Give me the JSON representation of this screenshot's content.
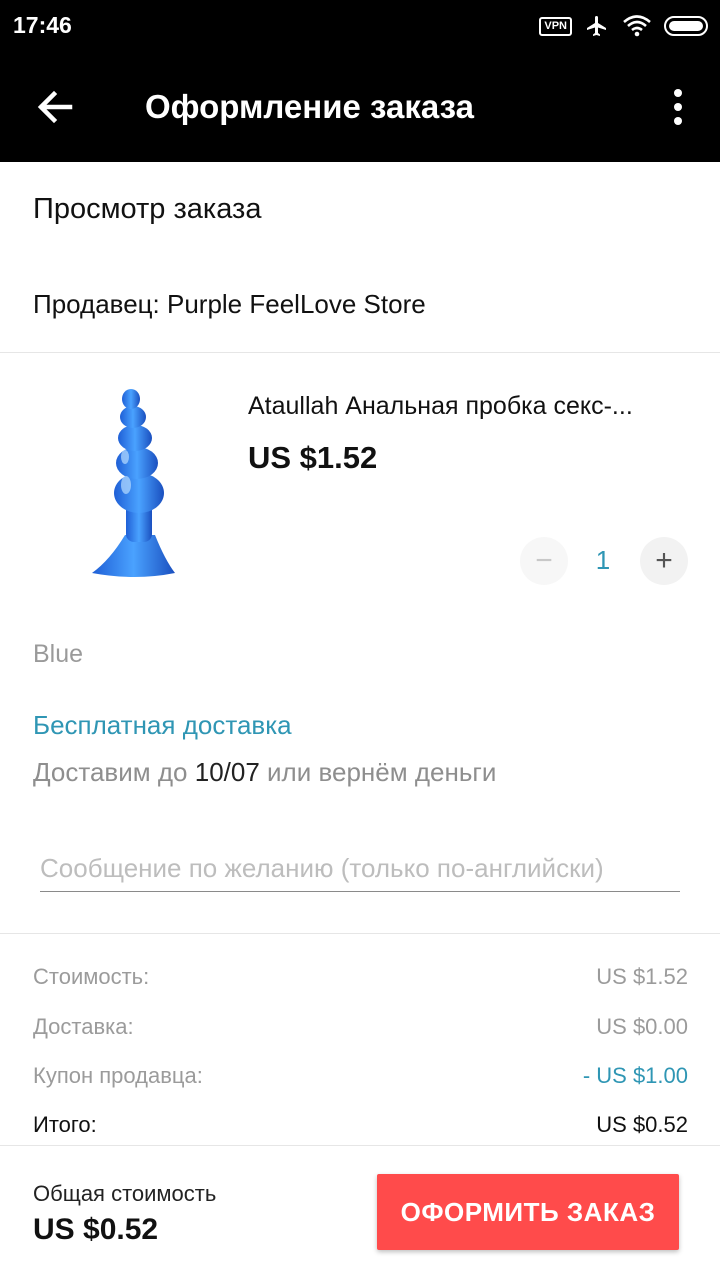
{
  "status_bar": {
    "time": "17:46",
    "vpn_label": "VPN",
    "icons": [
      "vpn-icon",
      "airplane-icon",
      "wifi-icon",
      "battery-icon"
    ]
  },
  "appbar": {
    "title": "Оформление заказа",
    "back_icon": "arrow-left-icon",
    "menu_icon": "more-vertical-icon"
  },
  "order_review": {
    "title": "Просмотр заказа",
    "seller": "Продавец: Purple FeelLove Store"
  },
  "product": {
    "name": "Ataullah Анальная пробка секс-...",
    "price": "US $1.52",
    "quantity": "1",
    "minus_label": "−",
    "plus_label": "+",
    "variant": "Blue",
    "shipping": "Бесплатная доставка",
    "delivery_prefix": "Доставим до ",
    "delivery_date": "10/07",
    "delivery_suffix": " или вернём деньги"
  },
  "message": {
    "placeholder": "Сообщение по желанию (только по-английски)",
    "value": ""
  },
  "summary": {
    "cost_label": "Стоимость:",
    "cost_value": "US $1.52",
    "shipping_label": "Доставка:",
    "shipping_value": "US $0.00",
    "coupon_label": "Купон продавца:",
    "coupon_value": "- US $1.00",
    "total_label": "Итого:",
    "total_value": "US $0.52"
  },
  "footer": {
    "total_label": "Общая стоимость",
    "total_price": "US $0.52",
    "order_button": "ОФОРМИТЬ ЗАКАЗ"
  },
  "colors": {
    "accent": "#2f96b4",
    "button": "#ff4b4b",
    "appbar": "#000000"
  }
}
